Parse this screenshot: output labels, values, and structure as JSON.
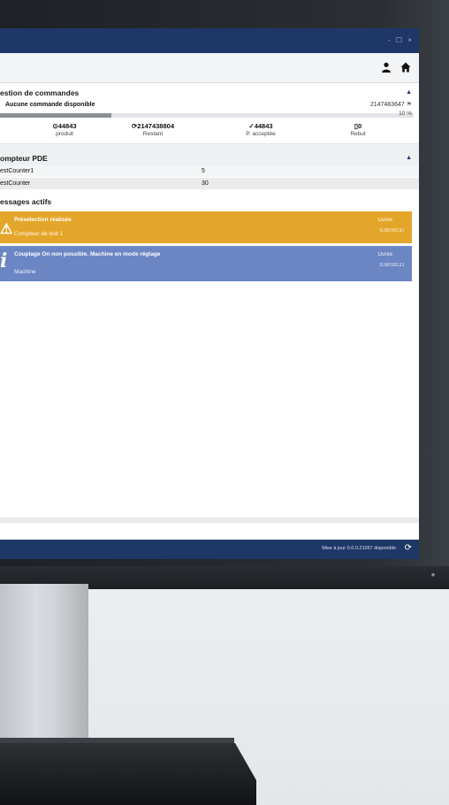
{
  "window": {
    "controls": "- ☐ ×"
  },
  "toolbar": {
    "user_icon": "user-icon",
    "home_icon": "home-icon"
  },
  "orders": {
    "title": "estion de commandes",
    "status": "Aucune commande disponible",
    "order_count": "2147483647",
    "progress_percent": 10,
    "progress_label": "10 %",
    "kpis": [
      {
        "value": "44843",
        "label": "produit"
      },
      {
        "value": "2147438804",
        "label": "Restant"
      },
      {
        "value": "44843",
        "label": "P. acceptée"
      },
      {
        "value": "0",
        "label": "Rebut"
      }
    ]
  },
  "pde": {
    "title": "ompteur PDE",
    "rows": [
      {
        "name": "estCounter1",
        "value": "5"
      },
      {
        "name": "estCounter",
        "value": "30"
      }
    ]
  },
  "messages": {
    "title": "essages actifs",
    "items": [
      {
        "type": "warning",
        "title": "Présélection réalisée",
        "subtitle": "Compteur de test 1",
        "duration_label": "Durée",
        "duration": "0.00:00:37",
        "color": "#e4a62a"
      },
      {
        "type": "info",
        "title": "Couplage On non possible. Machine en mode réglage",
        "subtitle": "Machine",
        "duration_label": "Durée",
        "duration": "0.00:00:27",
        "color": "#6c86c3"
      }
    ]
  },
  "statusbar": {
    "update_text": "Mise à jour 0.0.0.21057 disponible"
  },
  "colors": {
    "titlebar": "#1f3766",
    "warning": "#e4a62a",
    "info": "#6c86c3"
  }
}
